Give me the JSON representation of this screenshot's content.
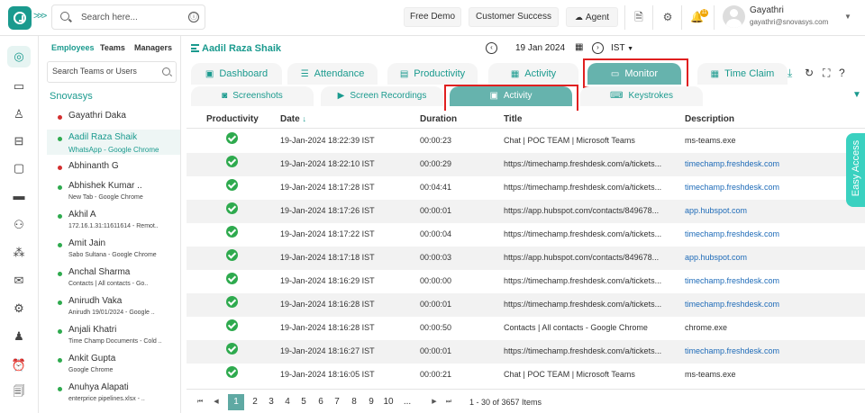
{
  "topbar": {
    "search_placeholder": "Search here...",
    "free_demo": "Free Demo",
    "customer_success": "Customer Success",
    "agent": "Agent",
    "notification_count": "11",
    "user_name": "Gayathri",
    "user_email": "gayathri@snovasys.com",
    "info_icon": "ⓘ"
  },
  "userpanel": {
    "tabs": [
      "Employees",
      "Teams",
      "Managers"
    ],
    "search_placeholder": "Search Teams or Users",
    "org": "Snovasys",
    "users": [
      {
        "name": "Gayathri Daka",
        "sub": "",
        "status": "#d32f2f"
      },
      {
        "name": "Aadil Raza Shaik",
        "sub": "WhatsApp - Google Chrome",
        "status": "#2eaa4e"
      },
      {
        "name": "Abhinanth G",
        "sub": "",
        "status": "#d32f2f"
      },
      {
        "name": "Abhishek Kumar ..",
        "sub": "New Tab - Google Chrome",
        "status": "#2eaa4e"
      },
      {
        "name": "Akhil A",
        "sub": "172.16.1.31:11611614 - Remot..",
        "status": "#2eaa4e"
      },
      {
        "name": "Amit Jain",
        "sub": "Sabo Sultana - Google Chrome",
        "status": "#2eaa4e"
      },
      {
        "name": "Anchal Sharma",
        "sub": "Contacts | All contacts - Go..",
        "status": "#2eaa4e"
      },
      {
        "name": "Anirudh Vaka",
        "sub": "Anirudh 19/01/2024 - Google ..",
        "status": "#2eaa4e"
      },
      {
        "name": "Anjali Khatri",
        "sub": "Time Champ Documents - Cold ..",
        "status": "#2eaa4e"
      },
      {
        "name": "Ankit Gupta",
        "sub": "Google Chrome",
        "status": "#2eaa4e"
      },
      {
        "name": "Anuhya Alapati",
        "sub": "enterprice pipelines.xlsx - ..",
        "status": "#2eaa4e"
      }
    ]
  },
  "main": {
    "employee_name": "Aadil Raza Shaik",
    "date": "19 Jan 2024",
    "timezone": "IST",
    "prev": "‹",
    "next": "›",
    "tabs": [
      "Dashboard",
      "Attendance",
      "Productivity",
      "Activity",
      "Monitor",
      "Time Claim"
    ],
    "subtabs": [
      "Screenshots",
      "Screen Recordings",
      "Activity",
      "Keystrokes"
    ],
    "columns": [
      "Productivity",
      "Date",
      "Duration",
      "Title",
      "Description"
    ],
    "rows": [
      {
        "date": "19-Jan-2024 18:22:39 IST",
        "duration": "00:00:23",
        "title": "Chat | POC TEAM | Microsoft Teams",
        "desc": "ms-teams.exe",
        "link": false
      },
      {
        "date": "19-Jan-2024 18:22:10 IST",
        "duration": "00:00:29",
        "title": "https://timechamp.freshdesk.com/a/tickets...",
        "desc": "timechamp.freshdesk.com",
        "link": true
      },
      {
        "date": "19-Jan-2024 18:17:28 IST",
        "duration": "00:04:41",
        "title": "https://timechamp.freshdesk.com/a/tickets...",
        "desc": "timechamp.freshdesk.com",
        "link": true
      },
      {
        "date": "19-Jan-2024 18:17:26 IST",
        "duration": "00:00:01",
        "title": "https://app.hubspot.com/contacts/849678...",
        "desc": "app.hubspot.com",
        "link": true
      },
      {
        "date": "19-Jan-2024 18:17:22 IST",
        "duration": "00:00:04",
        "title": "https://timechamp.freshdesk.com/a/tickets...",
        "desc": "timechamp.freshdesk.com",
        "link": true
      },
      {
        "date": "19-Jan-2024 18:17:18 IST",
        "duration": "00:00:03",
        "title": "https://app.hubspot.com/contacts/849678...",
        "desc": "app.hubspot.com",
        "link": true
      },
      {
        "date": "19-Jan-2024 18:16:29 IST",
        "duration": "00:00:00",
        "title": "https://timechamp.freshdesk.com/a/tickets...",
        "desc": "timechamp.freshdesk.com",
        "link": true
      },
      {
        "date": "19-Jan-2024 18:16:28 IST",
        "duration": "00:00:01",
        "title": "https://timechamp.freshdesk.com/a/tickets...",
        "desc": "timechamp.freshdesk.com",
        "link": true
      },
      {
        "date": "19-Jan-2024 18:16:28 IST",
        "duration": "00:00:50",
        "title": "Contacts | All contacts - Google Chrome",
        "desc": "chrome.exe",
        "link": false
      },
      {
        "date": "19-Jan-2024 18:16:27 IST",
        "duration": "00:00:01",
        "title": "https://timechamp.freshdesk.com/a/tickets...",
        "desc": "timechamp.freshdesk.com",
        "link": true
      },
      {
        "date": "19-Jan-2024 18:16:05 IST",
        "duration": "00:00:21",
        "title": "Chat | POC TEAM | Microsoft Teams",
        "desc": "ms-teams.exe",
        "link": false
      }
    ],
    "pager": {
      "pages": [
        "1",
        "2",
        "3",
        "4",
        "5",
        "6",
        "7",
        "8",
        "9",
        "10",
        "..."
      ],
      "info": "1 - 30 of 3657 Items",
      "first": "⏮",
      "prev": "◀",
      "next": "▶",
      "last": "⏭"
    }
  },
  "easy_access": "Easy Access",
  "colors": {
    "accent": "#1a9a8e",
    "tab_active": "#66b3ad",
    "highlight": "#e02020",
    "productive": "#2eaa4e",
    "link": "#1e6bb8"
  }
}
